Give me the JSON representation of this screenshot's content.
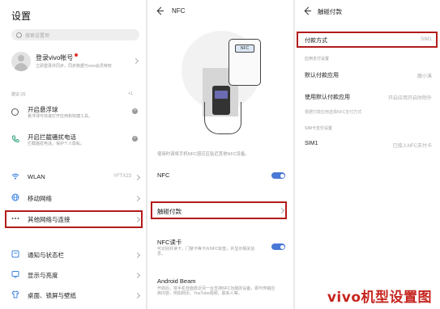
{
  "settings": {
    "title": "设置",
    "search_placeholder": "搜索设置项",
    "account": {
      "name": "登录vivo帐号",
      "sub": "立即登录并同步，同步数据与vivo会员特权"
    },
    "suggestions_label": "建议 (3)",
    "suggestions_count": "+1",
    "suggestions": [
      {
        "title": "开启悬浮球",
        "sub": "悬浮球可快速打开应用和快捷工具。"
      },
      {
        "title": "开启拦截骚扰电话",
        "sub": "拦截骚扰电话，保护个人隐私。"
      }
    ],
    "rows": [
      {
        "label": "WLAN",
        "value": "YFTX23"
      },
      {
        "label": "移动网络",
        "value": ""
      },
      {
        "label": "其他网络与连接",
        "value": ""
      },
      {
        "label": "通知与状态栏",
        "value": ""
      },
      {
        "label": "显示与亮度",
        "value": ""
      },
      {
        "label": "桌面、锁屏与壁纸",
        "value": ""
      }
    ]
  },
  "nfc": {
    "title": "NFC",
    "tag_label": "NFC",
    "desc": "使用时请将手机NFC感应区贴近其他NFC设备。",
    "rows": [
      {
        "label": "NFC",
        "toggle": true,
        "sub": ""
      },
      {
        "label": "触碰付款",
        "toggle": false,
        "sub": ""
      },
      {
        "label": "NFC读卡",
        "toggle": true,
        "sub": "可识别并读卡，门禁卡等卡片NFC标签，并显示相关信息。"
      },
      {
        "label": "Android Beam",
        "toggle": false,
        "sub": "开启后，将手机背面靠近另一台支持NFC功能的设备，即可传输应用内容，例如网页、YouTube视频、联系人等。"
      }
    ]
  },
  "tap_pay": {
    "title": "触碰付款",
    "payment_method_label": "付款方式",
    "payment_method_value": "SIM1",
    "app_section": "应用支付设置",
    "default_app_label": "默认付款应用",
    "default_app_value": "跟小溪",
    "use_default_label": "使用默认付款应用",
    "use_default_value": "开启应用开启时除外",
    "note": "根据付款应用选择NFC支付方式",
    "sim_section": "SIM卡支付设置",
    "sim1_label": "SIM1",
    "sim1_value": "已接入NFC支付卡"
  },
  "watermark": "vivo机型设置图",
  "colors": {
    "highlight": "#b31b1b",
    "toggle": "#4a78d6",
    "watermark": "#c6251f"
  }
}
